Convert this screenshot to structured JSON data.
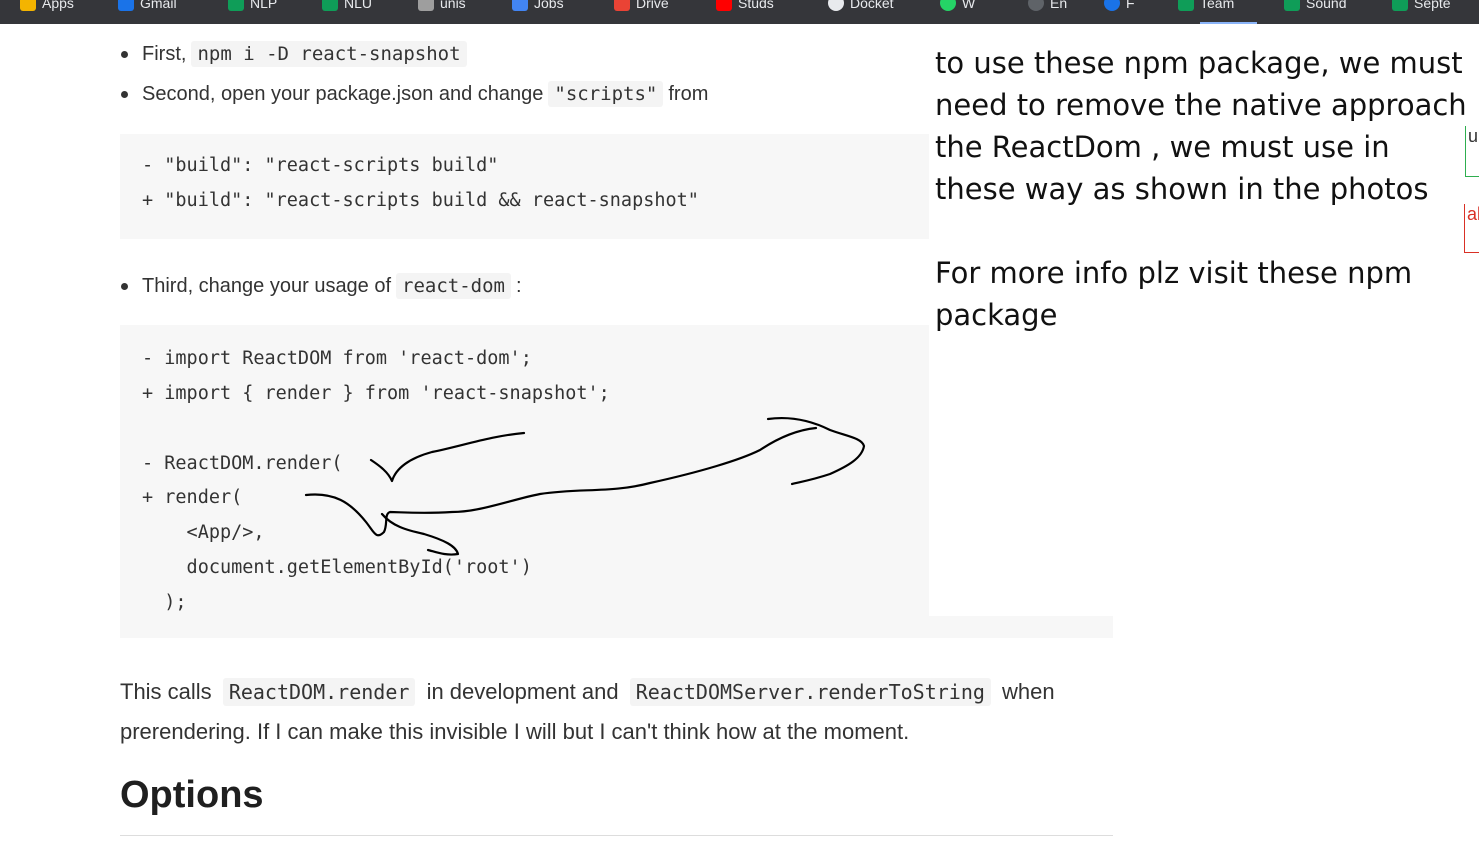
{
  "bookmarks": [
    {
      "label": "Apps",
      "color": "#f4b400"
    },
    {
      "label": "Gmail",
      "color": "#1a73e8"
    },
    {
      "label": "NLP",
      "color": "#0f9d58"
    },
    {
      "label": "NLU",
      "color": "#0f9d58"
    },
    {
      "label": "unis",
      "color": "#9e9e9e"
    },
    {
      "label": "Jobs",
      "color": "#4285f4"
    },
    {
      "label": "Drive",
      "color": "#ea4335"
    },
    {
      "label": "Studs",
      "color": "#ff0000"
    },
    {
      "label": "Docket",
      "color": "#e8eaed"
    },
    {
      "label": "W",
      "color": "#25d366"
    },
    {
      "label": "En",
      "color": "#5f6368"
    },
    {
      "label": "F",
      "color": "#1a73e8"
    },
    {
      "label": "Team",
      "color": "#0f9d58"
    },
    {
      "label": "Sound",
      "color": "#0f9d58"
    },
    {
      "label": "Septe",
      "color": "#0f9d58"
    }
  ],
  "article": {
    "step1": {
      "prefix": "First,",
      "code": "npm i -D react-snapshot"
    },
    "step2": {
      "prefix": "Second, open your package.json and change",
      "code": "\"scripts\"",
      "suffix": "from"
    },
    "code_block_1": [
      "- \"build\": \"react-scripts build\"",
      "+ \"build\": \"react-scripts build && react-snapshot\""
    ],
    "step3": {
      "prefix": "Third, change your usage of",
      "code": "react-dom",
      "suffix": ":"
    },
    "code_block_2": [
      "- import ReactDOM from 'react-dom';",
      "+ import { render } from 'react-snapshot';",
      "",
      "- ReactDOM.render(",
      "+ render(",
      "    <App/>,",
      "    document.getElementById('root')",
      "  );"
    ],
    "paragraph": {
      "t1": "This calls",
      "code1": "ReactDOM.render",
      "t2": "in development and",
      "code2": "ReactDOMServer.renderToString",
      "t3": "when",
      "t4": "prerendering. If I can make this invisible I will but I can't think how at the moment."
    },
    "heading": "Options"
  },
  "annotation": {
    "note1": "to use these npm package, we must need to remove the native approach the ReactDom , we must use in these way as shown in the photos",
    "note2": "For more info plz visit these npm package"
  },
  "edge_fragments": {
    "green": "ur",
    "red": "al"
  }
}
